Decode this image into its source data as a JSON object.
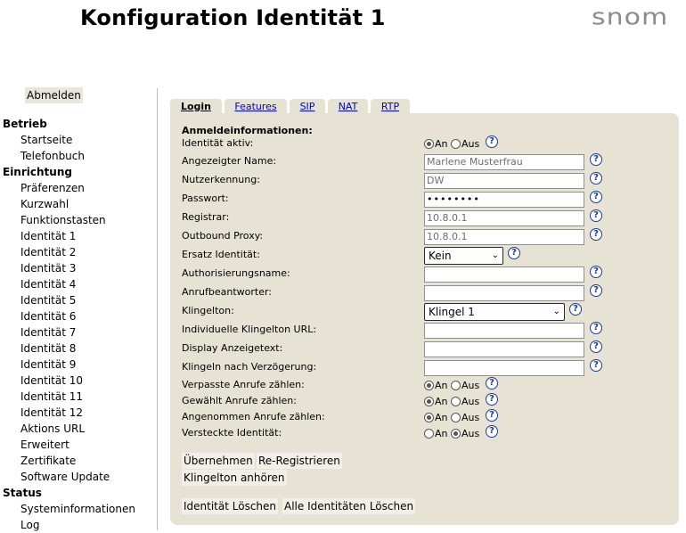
{
  "header": {
    "title": "Konfiguration Identität 1",
    "logo_text": "snom"
  },
  "logout_label": "Abmelden",
  "sidebar": {
    "sections": [
      {
        "title": "Betrieb",
        "items": [
          "Startseite",
          "Telefonbuch"
        ]
      },
      {
        "title": "Einrichtung",
        "items": [
          "Präferenzen",
          "Kurzwahl",
          "Funktionstasten",
          "Identität 1",
          "Identität 2",
          "Identität 3",
          "Identität 4",
          "Identität 5",
          "Identität 6",
          "Identität 7",
          "Identität 8",
          "Identität 9",
          "Identität 10",
          "Identität 11",
          "Identität 12",
          "Aktions URL",
          "Erweitert",
          "Zertifikate",
          "Software Update"
        ]
      },
      {
        "title": "Status",
        "items": [
          "Systeminformationen",
          "Log"
        ]
      }
    ]
  },
  "tabs": [
    {
      "label": "Login",
      "active": true
    },
    {
      "label": "Features",
      "active": false
    },
    {
      "label": "SIP",
      "active": false
    },
    {
      "label": "NAT",
      "active": false
    },
    {
      "label": "RTP",
      "active": false
    }
  ],
  "form": {
    "heading": "Anmeldeinformationen:",
    "radio_on": "An",
    "radio_off": "Aus",
    "help_symbol": "?",
    "fields": {
      "identity_active": {
        "label": "Identität aktiv:",
        "selected": "An"
      },
      "display_name": {
        "label": "Angezeigter Name:",
        "value": "Marlene Musterfrau"
      },
      "user_id": {
        "label": "Nutzerkennung:",
        "value": "DW"
      },
      "password": {
        "label": "Passwort:",
        "value": "••••••••"
      },
      "registrar": {
        "label": "Registrar:",
        "value": "10.8.0.1"
      },
      "outbound_proxy": {
        "label": "Outbound Proxy:",
        "value": "10.8.0.1"
      },
      "backup_identity": {
        "label": "Ersatz Identität:",
        "value": "Kein"
      },
      "auth_name": {
        "label": "Authorisierungsname:",
        "value": ""
      },
      "voicemail": {
        "label": "Anrufbeantworter:",
        "value": ""
      },
      "ringtone": {
        "label": "Klingelton:",
        "value": "Klingel 1"
      },
      "custom_ringtone_url": {
        "label": "Individuelle Klingelton URL:",
        "value": ""
      },
      "display_text": {
        "label": "Display Anzeigetext:",
        "value": ""
      },
      "ring_delay": {
        "label": "Klingeln nach Verzögerung:",
        "value": ""
      },
      "count_missed": {
        "label": "Verpasste Anrufe zählen:",
        "selected": "An"
      },
      "count_dialed": {
        "label": "Gewählt Anrufe zählen:",
        "selected": "An"
      },
      "count_received": {
        "label": "Angenommen Anrufe zählen:",
        "selected": "An"
      },
      "hidden_identity": {
        "label": "Versteckte Identität:",
        "selected": "Aus"
      }
    }
  },
  "buttons": {
    "apply": "Übernehmen",
    "reregister": "Re-Registrieren",
    "play_ringtone": "Klingelton anhören",
    "delete_identity": "Identität Löschen",
    "delete_all": "Alle Identitäten Löschen"
  }
}
